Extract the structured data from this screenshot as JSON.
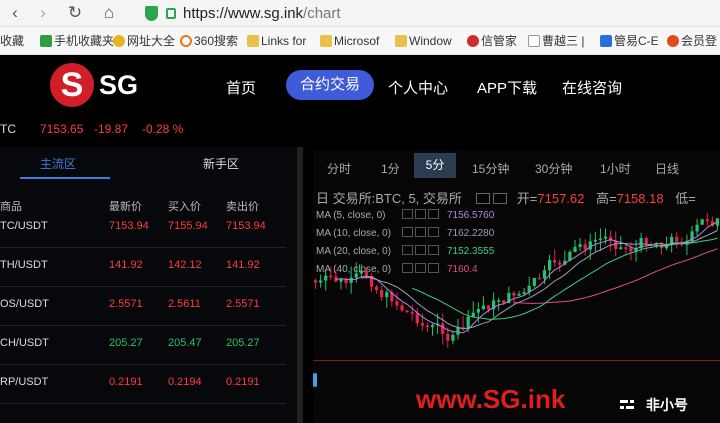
{
  "browser": {
    "url_host": "https://www.sg.ink",
    "url_path": "/chart",
    "bookmarks": [
      {
        "label": "收藏",
        "icon": "star-icon"
      },
      {
        "label": "手机收藏夹",
        "icon": "phone-icon"
      },
      {
        "label": "网址大全",
        "icon": "globe-icon"
      },
      {
        "label": "360搜索",
        "icon": "search-icon"
      },
      {
        "label": "Links for",
        "icon": "folder-icon"
      },
      {
        "label": "Microsof",
        "icon": "folder-icon"
      },
      {
        "label": "Window",
        "icon": "folder-icon"
      },
      {
        "label": "信管家",
        "icon": "app-icon"
      },
      {
        "label": "曹越三 |",
        "icon": "page-icon"
      },
      {
        "label": "管易C-E",
        "icon": "g-icon"
      },
      {
        "label": "会员登",
        "icon": "s-icon"
      }
    ]
  },
  "site": {
    "logo_text": "SG",
    "logo_mark": "S",
    "nav": [
      "首页",
      "合约交易",
      "个人中心",
      "APP下载",
      "在线咨询"
    ],
    "active_nav": "合约交易"
  },
  "ticker": {
    "symbol": "TC",
    "price": "7153.65",
    "change": "-19.87",
    "change_pct": "-0.28 %"
  },
  "market": {
    "tabs": [
      "主流区",
      "新手区"
    ],
    "headers": [
      "商品",
      "最新价",
      "买入价",
      "卖出价"
    ],
    "rows": [
      {
        "symbol": "TC/USDT",
        "last": "7153.94",
        "bid": "7155.94",
        "ask": "7153.94",
        "color": "#ff3b3b"
      },
      {
        "symbol": "TH/USDT",
        "last": "141.92",
        "bid": "142.12",
        "ask": "141.92",
        "color": "#ff3b3b"
      },
      {
        "symbol": "OS/USDT",
        "last": "2.5571",
        "bid": "2.5611",
        "ask": "2.5571",
        "color": "#ff3b3b"
      },
      {
        "symbol": "CH/USDT",
        "last": "205.27",
        "bid": "205.47",
        "ask": "205.27",
        "color": "#26c26c"
      },
      {
        "symbol": "RP/USDT",
        "last": "0.2191",
        "bid": "0.2194",
        "ask": "0.2191",
        "color": "#ff3b3b"
      }
    ]
  },
  "chart": {
    "timeframes": [
      "分时",
      "1分",
      "5分",
      "15分钟",
      "30分钟",
      "1小时",
      "日线"
    ],
    "active_tf": "5分",
    "title": "日 交易所:BTC, 5, 交易所",
    "open_label": "开=",
    "open_value": "7157.62",
    "high_label": "高=",
    "high_value": "7158.18",
    "low_label": "低=",
    "ma": [
      {
        "label": "MA (5, close, 0)",
        "value": "7156.5760",
        "color": "#b585e6"
      },
      {
        "label": "MA (10, close, 0)",
        "value": "7162.2280",
        "color": "#9aa0b5"
      },
      {
        "label": "MA (20, close, 0)",
        "value": "7152.3555",
        "color": "#35d07f"
      },
      {
        "label": "MA (40, close, 0)",
        "value": "7160.4",
        "color": "#e04f8a"
      }
    ],
    "watermark": "www.SG.ink",
    "badge": "非小号"
  },
  "colors": {
    "up": "#26c26c",
    "down": "#ff3b3b",
    "accent": "#3f5bd8",
    "brand": "#d11f2a"
  }
}
